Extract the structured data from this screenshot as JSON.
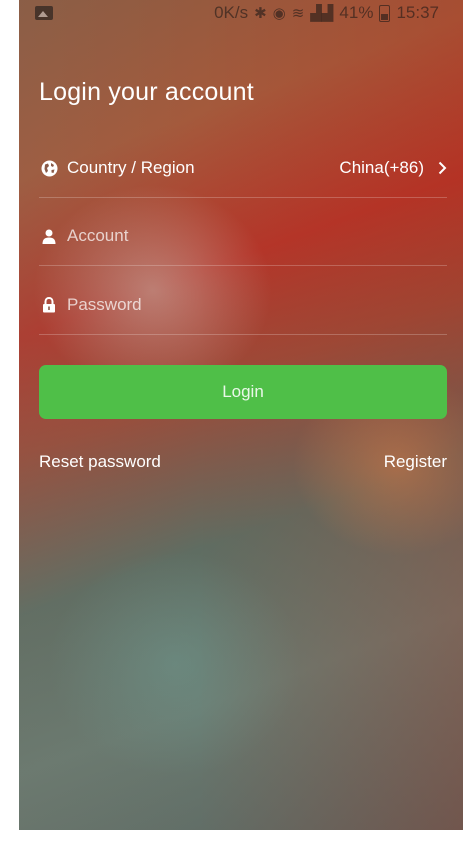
{
  "status_bar": {
    "speed": "0K/s",
    "battery_percent": "41%",
    "time": "15:37"
  },
  "login": {
    "title": "Login your account",
    "country_label": "Country / Region",
    "country_value": "China(+86)",
    "account_placeholder": "Account",
    "password_placeholder": "Password",
    "login_button": "Login",
    "reset_password": "Reset password",
    "register": "Register"
  },
  "icons": {
    "country": "globe-icon",
    "account": "user-icon",
    "password": "lock-icon",
    "chevron": "chevron-right-icon"
  },
  "colors": {
    "accent": "#4fbf48"
  }
}
